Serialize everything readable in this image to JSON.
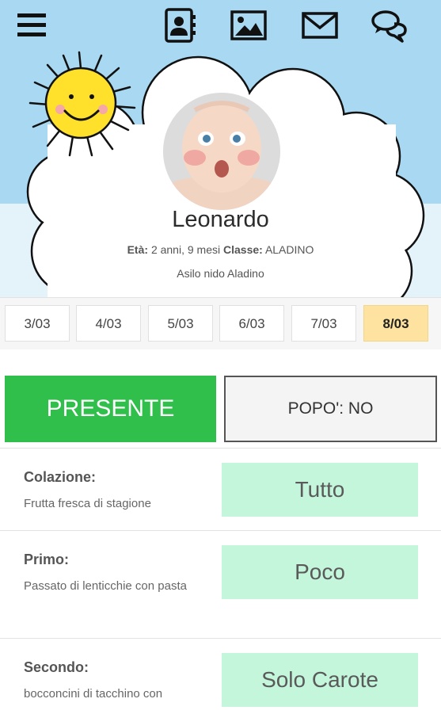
{
  "toolbar": {
    "menu_icon": "hamburger-menu-icon",
    "contacts_icon": "address-book-icon",
    "gallery_icon": "image-icon",
    "mail_icon": "envelope-icon",
    "chat_icon": "chat-bubbles-icon"
  },
  "profile": {
    "name": "Leonardo",
    "age_label": "Età:",
    "age_value": "2 anni, 9 mesi",
    "class_label": "Classe:",
    "class_value": "ALADINO",
    "school": "Asilo nido Aladino"
  },
  "dates": [
    "3/03",
    "4/03",
    "5/03",
    "6/03",
    "7/03",
    "8/03"
  ],
  "selected_date": "8/03",
  "status": {
    "presence": "PRESENTE",
    "poop": "POPO': NO"
  },
  "meals": [
    {
      "title": "Colazione:",
      "desc": "Frutta fresca di stagione",
      "value": "Tutto"
    },
    {
      "title": "Primo:",
      "desc": "Passato di lenticchie con pasta",
      "value": "Poco"
    },
    {
      "title": "Secondo:",
      "desc": "bocconcini di tacchino con",
      "value": "Solo Carote"
    }
  ],
  "colors": {
    "sky": "#a9d9f2",
    "present_green": "#2fbf4a",
    "selected_date": "#fde39f",
    "meal_value_bg": "#c4f6dc",
    "sun": "#ffe02a"
  }
}
